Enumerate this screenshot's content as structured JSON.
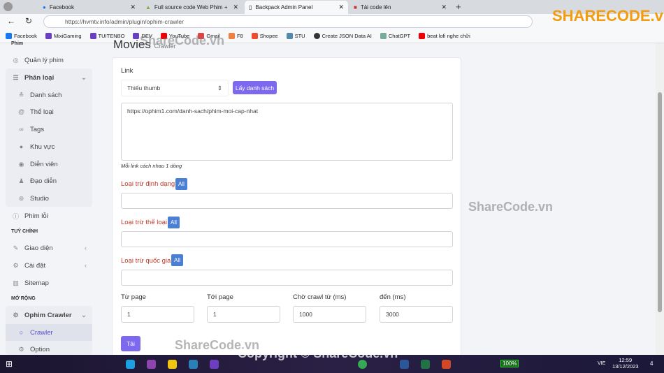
{
  "browser": {
    "tabs": [
      {
        "title": "Facebook",
        "icon": "facebook-icon"
      },
      {
        "title": "Full source code Web Phim + Cr",
        "icon": "sharecode-icon"
      },
      {
        "title": "Backpack Admin Panel",
        "icon": "page-icon"
      },
      {
        "title": "Tải code lên",
        "icon": "upload-icon"
      }
    ],
    "url": "https://hvmtv.info/admin/plugin/ophim-crawler",
    "bookmarks": [
      "Facebook",
      "MixiGaming",
      "TUITENBO",
      "DEV",
      "YouTube",
      "Gmail",
      "F8",
      "Shopee",
      "STU",
      "Create JSON Data AI",
      "ChatGPT",
      "beat lofi nghe chữi"
    ]
  },
  "sidebar": {
    "section_phim": "Phim",
    "items": [
      {
        "label": "Quản lý phim",
        "icon": "play-circle-icon"
      },
      {
        "label": "Phân loại",
        "icon": "list-icon"
      },
      {
        "label": "Danh sách",
        "icon": "stack-icon"
      },
      {
        "label": "Thể loại",
        "icon": "at-icon"
      },
      {
        "label": "Tags",
        "icon": "link-icon"
      },
      {
        "label": "Khu vực",
        "icon": "globe-icon"
      },
      {
        "label": "Diễn viên",
        "icon": "user-circle-icon"
      },
      {
        "label": "Đạo diễn",
        "icon": "person-icon"
      },
      {
        "label": "Studio",
        "icon": "studio-icon"
      },
      {
        "label": "Phim lỗi",
        "icon": "info-icon"
      }
    ],
    "section_custom": "TUỲ CHỈNH",
    "custom_items": [
      {
        "label": "Giao diện",
        "icon": "brush-icon"
      },
      {
        "label": "Cài đặt",
        "icon": "gear-icon"
      },
      {
        "label": "Sitemap",
        "icon": "map-icon"
      }
    ],
    "section_ext": "MỞ RỘNG",
    "ext_items": [
      {
        "label": "Ophim Crawler",
        "icon": "gear-icon"
      },
      {
        "label": "Crawler",
        "icon": "circle-icon"
      },
      {
        "label": "Option",
        "icon": "gear-icon"
      }
    ]
  },
  "page": {
    "title": "Movies",
    "subtitle": "Crawler"
  },
  "form": {
    "link_label": "Link",
    "select_value": "Thiếu thumb",
    "fetch_button": "Lấy danh sách",
    "textarea_value": "https://ophim1.com/danh-sach/phim-moi-cap-nhat",
    "help": "Mỗi link cách nhau 1 dòng",
    "exclude_format": "Loại trừ định dạng",
    "exclude_genre": "Loại trừ thể loại",
    "exclude_country": "Loại trừ quốc gia",
    "all": "All",
    "from_page_label": "Từ page",
    "from_page": "1",
    "to_page_label": "Tới page",
    "to_page": "1",
    "wait_label": "Chờ crawl từ (ms)",
    "wait": "1000",
    "to_ms_label": "đến (ms)",
    "to_ms": "3000",
    "submit": "Tải"
  },
  "watermark": {
    "logo": "SHARECODE.vn",
    "mid": "ShareCode.vn",
    "copyright": "Copyright © ShareCode.vn"
  },
  "taskbar": {
    "battery": "100%",
    "lang": "VIE",
    "time": "12:59",
    "date": "13/12/2023",
    "notif": "4"
  },
  "colors": {
    "accent": "#7c69ef",
    "all_badge": "#4a7fd4",
    "label_red": "#c0392b"
  }
}
